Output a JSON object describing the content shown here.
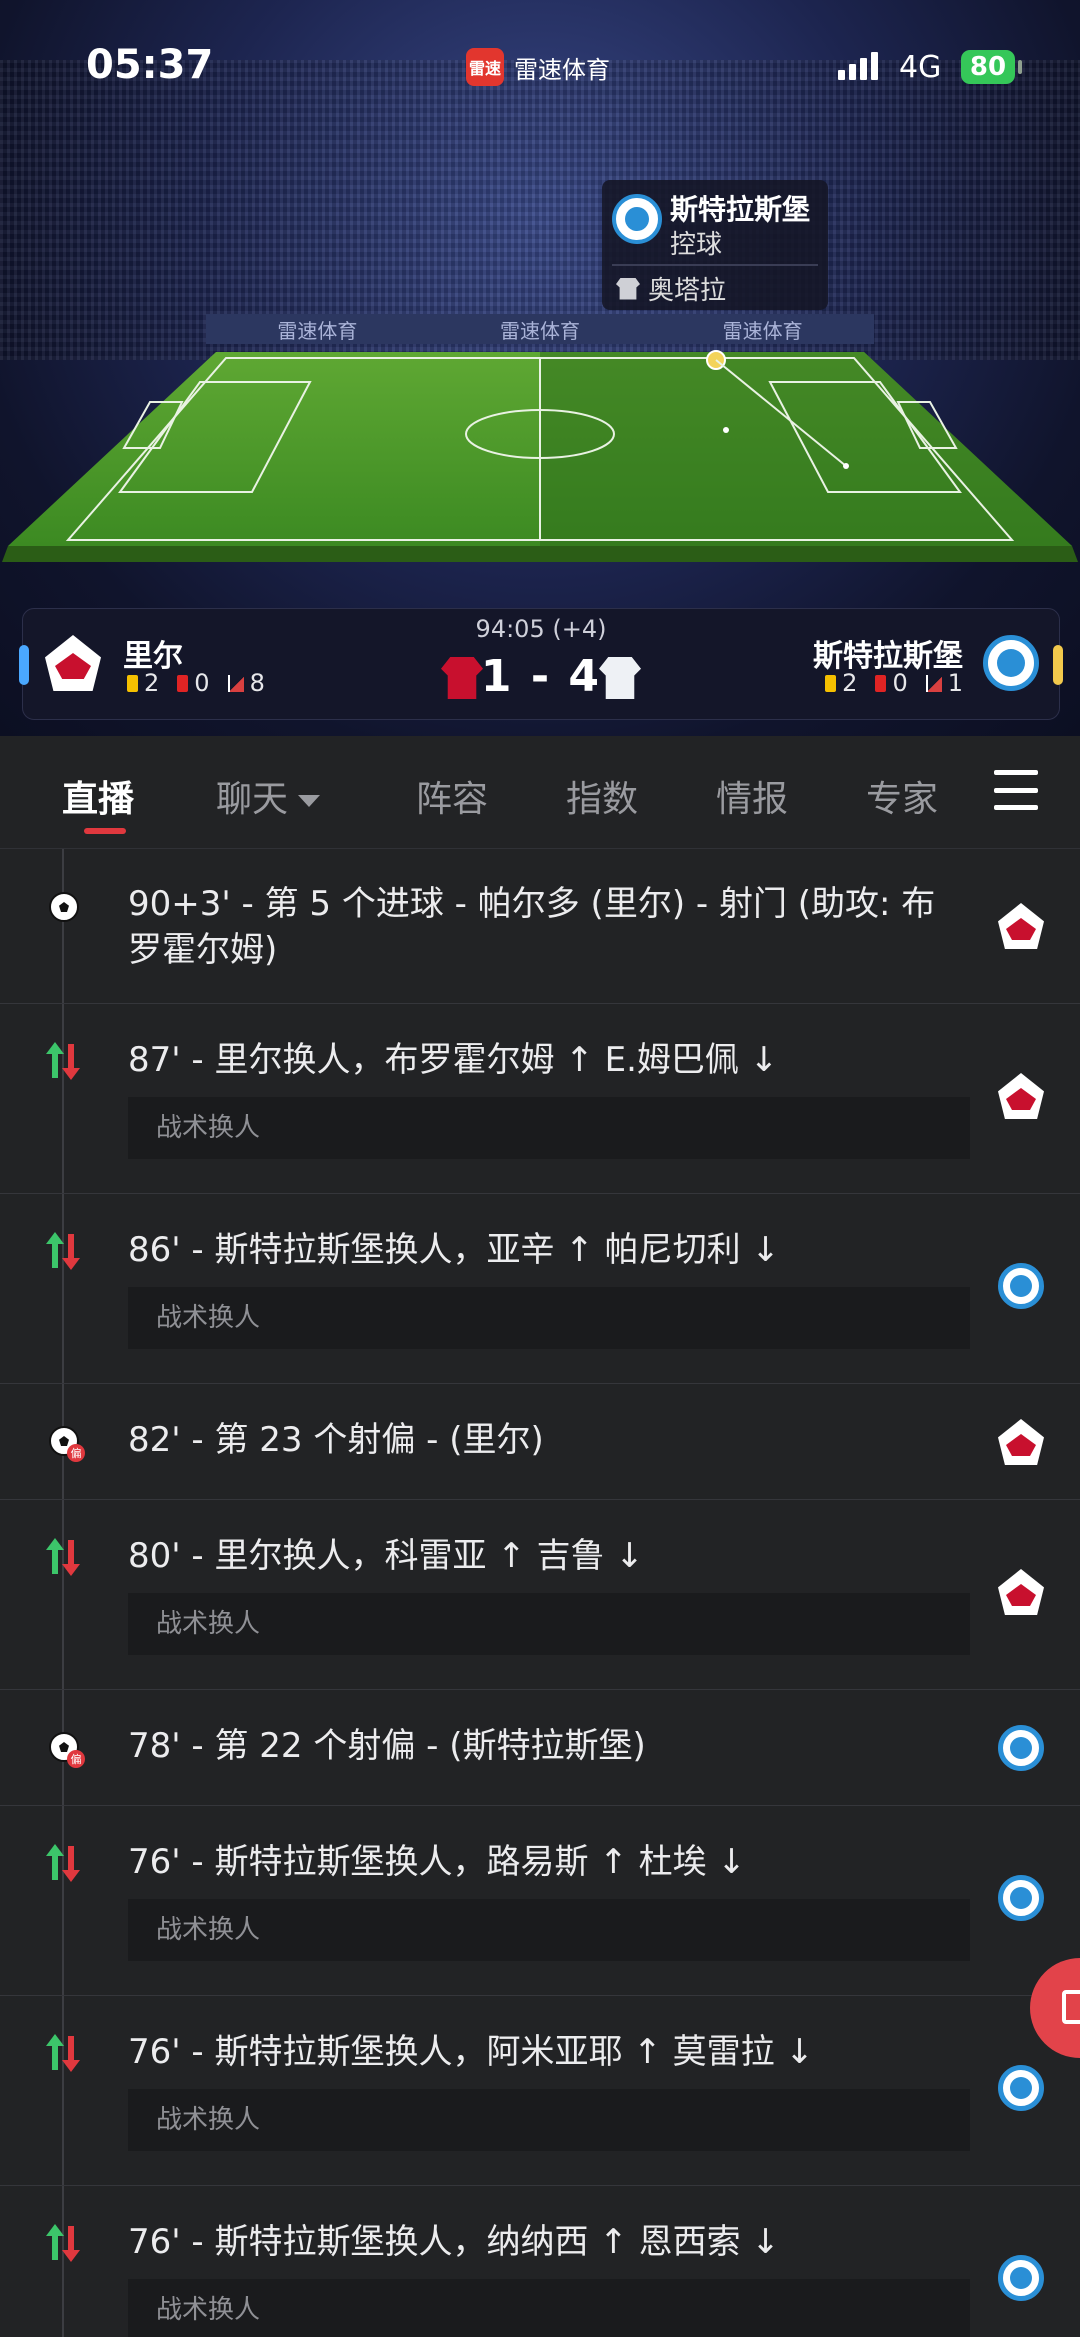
{
  "status_bar": {
    "time": "05:37",
    "app_name": "雷速体育",
    "app_logo_text": "雷速",
    "network": "4G",
    "battery": "80"
  },
  "field": {
    "ad_text": [
      "雷速体育",
      "雷速体育",
      "雷速体育"
    ],
    "possession": {
      "team": "斯特拉斯堡",
      "label": "控球",
      "player": "奥塔拉"
    }
  },
  "match": {
    "clock": "94:05 (+4)",
    "score": "1 - 4",
    "home": {
      "name": "里尔",
      "yellow": "2",
      "red": "0",
      "corners": "8",
      "color": "#c8102e"
    },
    "away": {
      "name": "斯特拉斯堡",
      "yellow": "2",
      "red": "0",
      "corners": "1",
      "color": "#2a8fd6"
    }
  },
  "tabs": {
    "live": "直播",
    "chat": "聊天",
    "lineup": "阵容",
    "odds": "指数",
    "intel": "情报",
    "expert": "专家"
  },
  "events": [
    {
      "type": "goal",
      "team": "lille",
      "text": "90+3' - 第 5 个进球 - 帕尔多 (里尔) - 射门 (助攻: 布罗霍尔姆)"
    },
    {
      "type": "sub",
      "team": "lille",
      "text": "87' - 里尔换人，布罗霍尔姆 ↑ E.姆巴佩 ↓",
      "note": "战术换人"
    },
    {
      "type": "sub",
      "team": "strasbourg",
      "text": "86' - 斯特拉斯堡换人，亚辛 ↑ 帕尼切利 ↓",
      "note": "战术换人"
    },
    {
      "type": "miss",
      "team": "lille",
      "text": "82' - 第 23 个射偏 - (里尔)"
    },
    {
      "type": "sub",
      "team": "lille",
      "text": "80' - 里尔换人，科雷亚 ↑ 吉鲁 ↓",
      "note": "战术换人"
    },
    {
      "type": "miss",
      "team": "strasbourg",
      "text": "78' - 第 22 个射偏 - (斯特拉斯堡)"
    },
    {
      "type": "sub",
      "team": "strasbourg",
      "text": "76' - 斯特拉斯堡换人，路易斯 ↑ 杜埃 ↓",
      "note": "战术换人"
    },
    {
      "type": "sub",
      "team": "strasbourg",
      "text": "76' - 斯特拉斯堡换人，阿米亚耶 ↑ 莫雷拉 ↓",
      "note": "战术换人"
    },
    {
      "type": "sub",
      "team": "strasbourg",
      "text": "76' - 斯特拉斯堡换人，纳纳西 ↑ 恩西索 ↓",
      "note": "战术换人"
    }
  ]
}
